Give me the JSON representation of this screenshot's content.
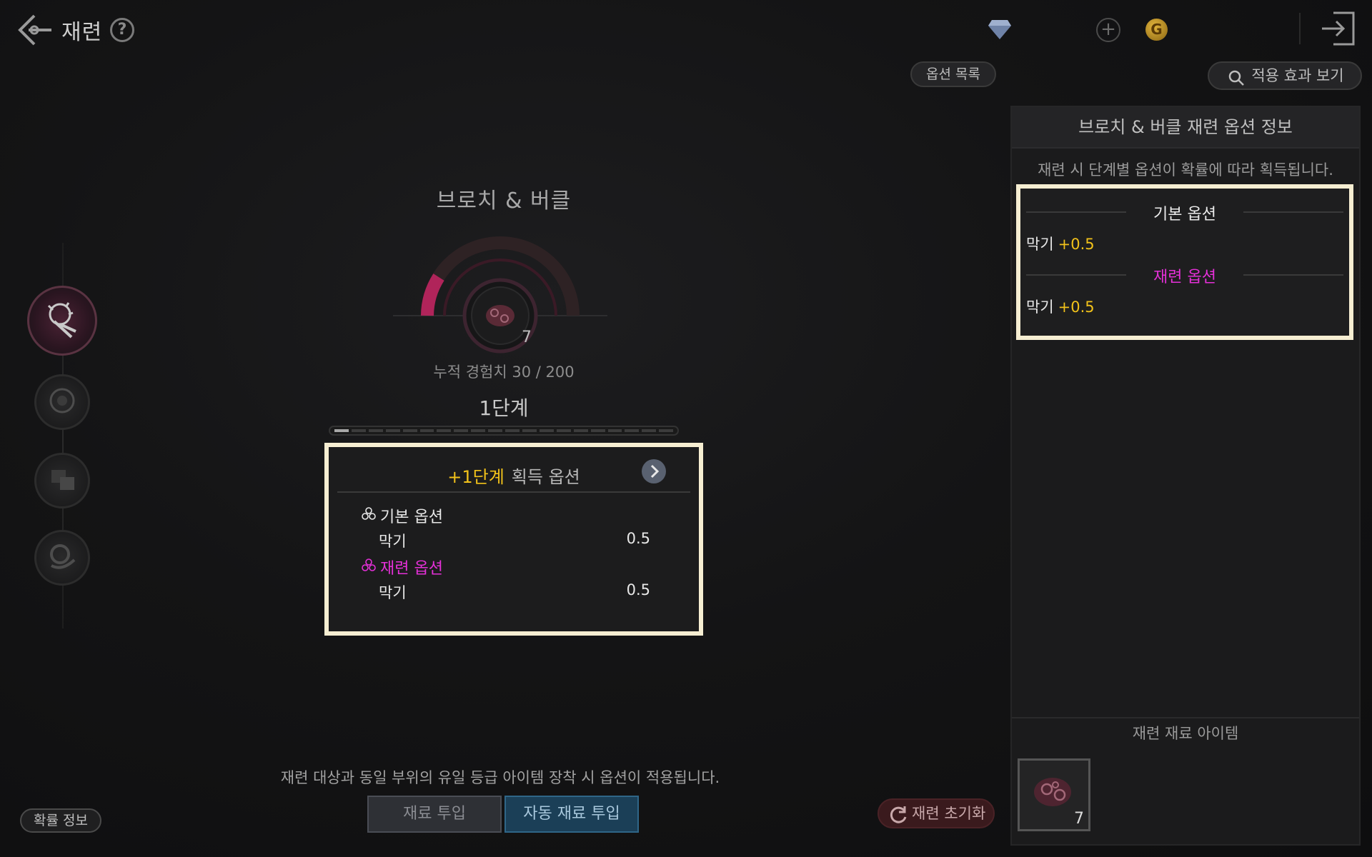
{
  "header": {
    "title": "재련",
    "help_label": "?",
    "plus_label": "+",
    "gold_label": "G"
  },
  "toolbar": {
    "option_list_label": "옵션 목록",
    "effect_view_label": "적용 효과 보기"
  },
  "item": {
    "name": "브로치 & 버클",
    "count": "7",
    "exp_text": "누적 경험치 30 / 200",
    "stage_text": "1단계",
    "stage_progress_segments": 20,
    "stage_progress_filled": 1
  },
  "gain_box": {
    "level_label": "+1단계",
    "title": "획득 옵션",
    "basic_option_label": "기본 옵션",
    "basic_stat_name": "막기",
    "basic_stat_value": "0.5",
    "refine_option_label": "재련 옵션",
    "refine_stat_name": "막기",
    "refine_stat_value": "0.5"
  },
  "bottom": {
    "notice": "재련 대상과 동일 부위의 유일 등급 아이템 장착 시 옵션이 적용됩니다.",
    "material_button": "재료 투입",
    "auto_material_button": "자동 재료 투입",
    "reset_button": "재련 초기화",
    "probability_button": "확률 정보"
  },
  "panel": {
    "title": "브로치 & 버클 재련 옵션 정보",
    "subtitle": "재련 시 단계별 옵션이 확률에 따라 획득됩니다.",
    "basic_option_label": "기본 옵션",
    "basic_stat_name": "막기",
    "basic_stat_value": "+0.5",
    "refine_option_label": "재련 옵션",
    "refine_stat_name": "막기",
    "refine_stat_value": "+0.5",
    "material_title": "재련 재료 아이템",
    "material_count": "7"
  },
  "colors": {
    "accent_yellow": "#f2c21a",
    "refine_magenta": "#e530d8",
    "highlight_frame": "#f6eed2",
    "auto_button_blue": "#1b3f57"
  },
  "icons": [
    "back-arrow-icon",
    "help-icon",
    "gem-icon",
    "plus-icon",
    "gold-coin-icon",
    "exit-icon",
    "search-icon",
    "triskele-icon",
    "chevron-right-icon",
    "refresh-icon",
    "brooch-icon"
  ]
}
